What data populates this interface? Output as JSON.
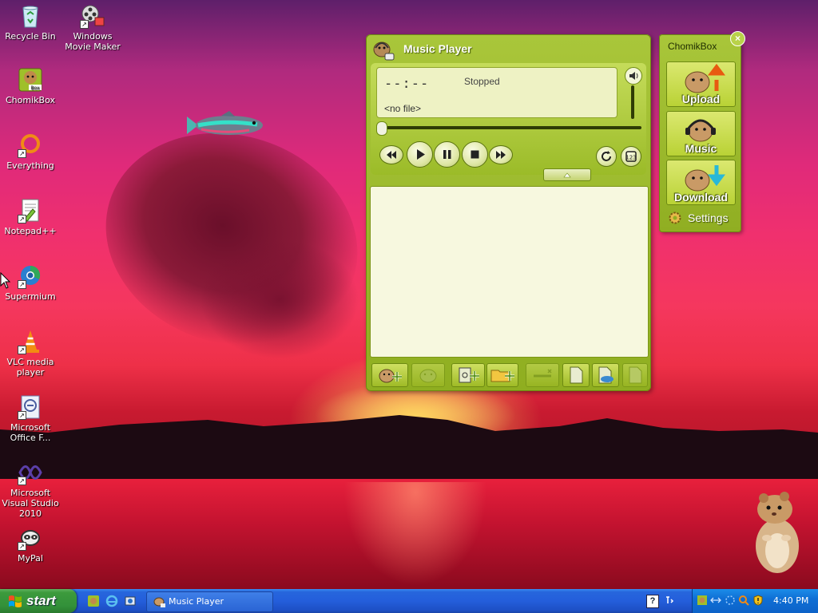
{
  "desktop": {
    "icons": [
      {
        "label": "Recycle Bin",
        "icon": "recycle-bin-icon"
      },
      {
        "label": "Windows Movie Maker",
        "icon": "movie-maker-icon"
      },
      {
        "label": "ChomikBox",
        "icon": "chomikbox-icon"
      },
      {
        "label": "Everything",
        "icon": "everything-search-icon"
      },
      {
        "label": "Notepad++",
        "icon": "notepad-plus-plus-icon"
      },
      {
        "label": "Supermium",
        "icon": "supermium-browser-icon"
      },
      {
        "label": "VLC media player",
        "icon": "vlc-cone-icon"
      },
      {
        "label": "Microsoft Office F...",
        "icon": "office-document-icon"
      },
      {
        "label": "Microsoft Visual Studio 2010",
        "icon": "visual-studio-icon"
      },
      {
        "label": "MyPal",
        "icon": "mypal-browser-icon"
      }
    ]
  },
  "player": {
    "title": "Music Player",
    "time": "--:--",
    "status": "Stopped",
    "file": "<no file>",
    "volume_level": 0.85,
    "seek_position": 0.0,
    "controls": [
      "rewind",
      "play",
      "pause",
      "stop",
      "fast-forward",
      "repeat",
      "shuffle"
    ],
    "bottom_buttons": [
      "add-from-chomik",
      "chomik-library",
      "add-file",
      "add-folder",
      "remove",
      "new-playlist",
      "save-playlist",
      "export-playlist"
    ]
  },
  "chomikbox": {
    "title": "ChomikBox",
    "close": "×",
    "upload_label": "Upload",
    "music_label": "Music",
    "download_label": "Download",
    "settings_label": "Settings"
  },
  "taskbar": {
    "start_label": "start",
    "task_label": "Music Player",
    "lang": "?",
    "clock": "4:40 PM"
  },
  "colors": {
    "player_green": "#a9c63a",
    "lcd": "#eef2c4",
    "playlist_bg": "#f7f8df",
    "taskbar_blue": "#245edb",
    "start_green": "#3c9a3c"
  }
}
